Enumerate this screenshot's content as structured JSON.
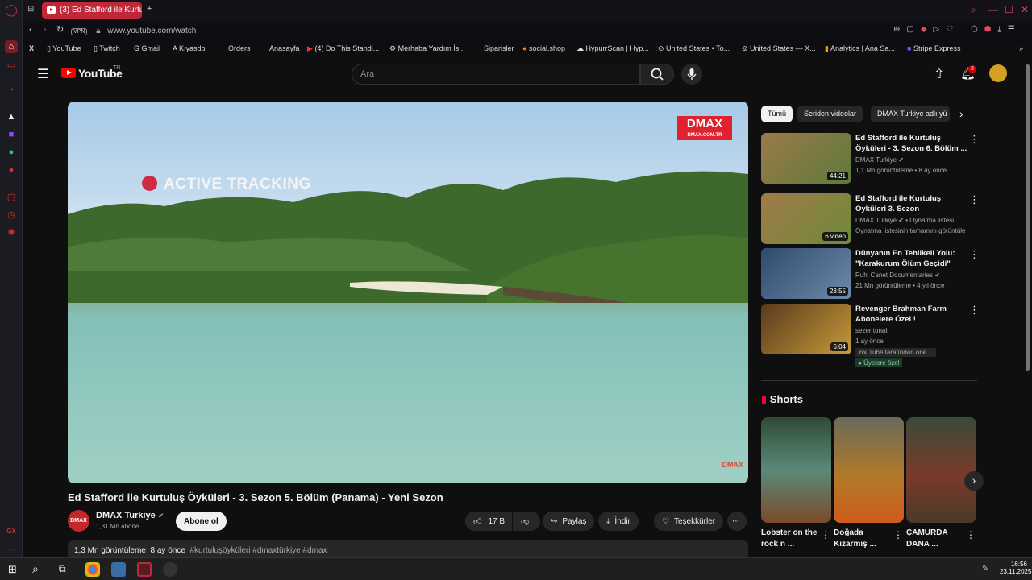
{
  "browser": {
    "tab_title": "(3) Ed Stafford ile Kurtu",
    "url": "www.youtube.com/watch",
    "vpn": "VPN",
    "rail_badge": "GX",
    "bookmarks": [
      "YouTube",
      "Twitch",
      "Gmail",
      "Kıyasdb",
      "Orders",
      "Anasayfa",
      "(4) Do This Standi...",
      "Merhaba Yardım İs...",
      "Siparisler",
      "social.shop",
      "HypurrScan | Hyp...",
      "United States • To...",
      "United States — X...",
      "Analytics | Ana Sa...",
      "Stripe Express"
    ]
  },
  "youtube": {
    "logo": "YouTube",
    "region": "TR",
    "search_placeholder": "Ara",
    "notif_count": "3",
    "video": {
      "overlay_text": "ACTIVE TRACKING",
      "brand": "DMAX",
      "brand_url": "DMAX.COM.TR",
      "watermark": "DMAX",
      "title": "Ed Stafford ile Kurtuluş Öyküleri - 3. Sezon 5. Bölüm (Panama) - Yeni Sezon",
      "channel": "DMAX Turkiye",
      "channel_avatar": "DMAX",
      "subscribers": "1,31 Mn abone",
      "subscribe": "Abone ol",
      "likes": "17 B",
      "share": "Paylaş",
      "download": "İndir",
      "thanks": "Teşekkürler",
      "views": "1,3 Mn görüntüleme",
      "age": "8 ay önce",
      "tags": "#kurtuluşöyküleri #dmaxtürkiye #dmax"
    },
    "chips": [
      "Tümü",
      "Seriden videolar",
      "DMAX Turkiye adlı yü"
    ],
    "recommendations": [
      {
        "title": "Ed Stafford ile Kurtuluş Öyküleri - 3. Sezon 6. Bölüm ...",
        "channel": "DMAX Turkiye",
        "meta": "1,1 Mn görüntüleme • 8 ay önce",
        "duration": "44:21"
      },
      {
        "title": "Ed Stafford ile Kurtuluş Öyküleri 3. Sezon",
        "channel": "DMAX Turkiye",
        "extra": "• Oynatma listesi",
        "meta": "Oynatma listesinin tamamını görüntüle",
        "duration": "6 video"
      },
      {
        "title": "Dünyanın En Tehlikeli Yolu: \"Karakurum Ölüm Geçidi\"",
        "channel": "Ruhi Cenet Documentaries",
        "meta": "21 Mn görüntüleme • 4 yıl önce",
        "duration": "23:55"
      },
      {
        "title": "Revenger Brahman Farm Abonelere Özel !",
        "channel": "sezer tunalı",
        "meta": "1 ay önce",
        "note": "YouTube tarafından öne ...",
        "badge": "Üyelere özel",
        "duration": "6:04"
      }
    ],
    "shorts_title": "Shorts",
    "shorts": [
      {
        "title": "Lobster on the rock n ..."
      },
      {
        "title": "Doğada Kızarmış ..."
      },
      {
        "title": "ÇAMURDA DANA ..."
      }
    ]
  },
  "taskbar": {
    "time": "16:56",
    "date": "23.11.2025"
  },
  "colors": {
    "accent": "#ff0000",
    "opera": "#c0283a",
    "bg": "#0f0f0f"
  }
}
